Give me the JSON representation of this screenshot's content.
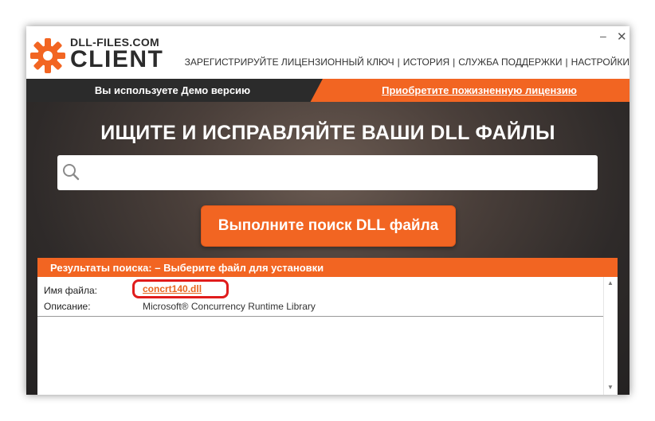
{
  "app": {
    "logo_top": "DLL-FILES.COM",
    "logo_bottom": "CLIENT",
    "minimize_label": "–",
    "close_label": "✕"
  },
  "nav": {
    "items": [
      {
        "label": "ЗАРЕГИСТРИРУЙТЕ ЛИЦЕНЗИОННЫЙ КЛЮЧ"
      },
      {
        "label": "ИСТОРИЯ"
      },
      {
        "label": "СЛУЖБА ПОДДЕРЖКИ"
      },
      {
        "label": "НАСТРОЙКИ"
      }
    ],
    "separator": "|"
  },
  "banner": {
    "demo_text": "Вы используете Демо версию",
    "buy_text": "Приобретите пожизненную лицензию"
  },
  "hero": {
    "title": "ИЩИТЕ И ИСПРАВЛЯЙТЕ ВАШИ DLL ФАЙЛЫ",
    "search_value": "",
    "search_button": "Выполните поиск DLL файла"
  },
  "results": {
    "header": "Результаты поиска:  – Выберите файл для установки",
    "file_label": "Имя файла:",
    "file_value": "concrt140.dll",
    "desc_label": "Описание:",
    "desc_value": "Microsoft® Concurrency Runtime Library"
  },
  "icons": [
    "logo-gear-icon",
    "search-icon",
    "scroll-up-icon",
    "scroll-down-icon"
  ],
  "colors": {
    "accent": "#f26522",
    "highlight": "#e01c1c",
    "dark_banner": "#2b2b2b",
    "link": "#e8651f"
  }
}
